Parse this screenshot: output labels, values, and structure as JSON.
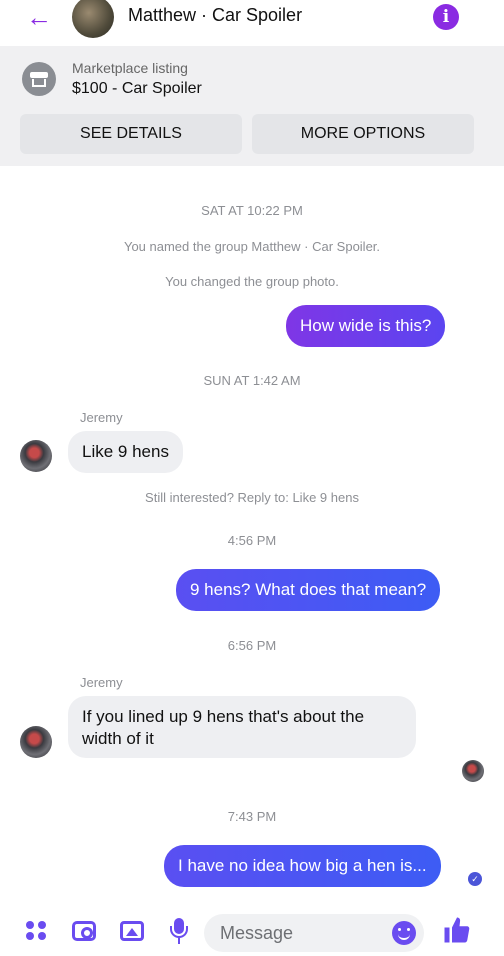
{
  "header": {
    "back_icon": "arrow-left-icon",
    "title": "Matthew · Car Spoiler",
    "info_icon": "info-icon"
  },
  "listing": {
    "label": "Marketplace listing",
    "price_title": "$100 - Car Spoiler",
    "see_details": "SEE DETAILS",
    "more_options": "MORE OPTIONS"
  },
  "messages": {
    "ts1": "SAT AT 10:22 PM",
    "sys1": "You named the group Matthew · Car Spoiler.",
    "sys2": "You changed the group photo.",
    "out1": "How wide is this?",
    "ts2": "SUN AT 1:42 AM",
    "sender1": "Jeremy",
    "in1": "Like 9 hens",
    "reply_hint": "Still interested? Reply to: Like 9 hens",
    "ts3": "4:56 PM",
    "out2": "9 hens? What does that mean?",
    "ts4": "6:56 PM",
    "sender2": "Jeremy",
    "in2": "If you lined up 9 hens that's about the width of it",
    "ts5": "7:43 PM",
    "out3": "I have no idea how big a hen is..."
  },
  "composer": {
    "placeholder": "Message"
  },
  "colors": {
    "accent": "#8a2be2",
    "bubble_out": "#5b45f0",
    "bubble_in": "#eeeff2"
  }
}
